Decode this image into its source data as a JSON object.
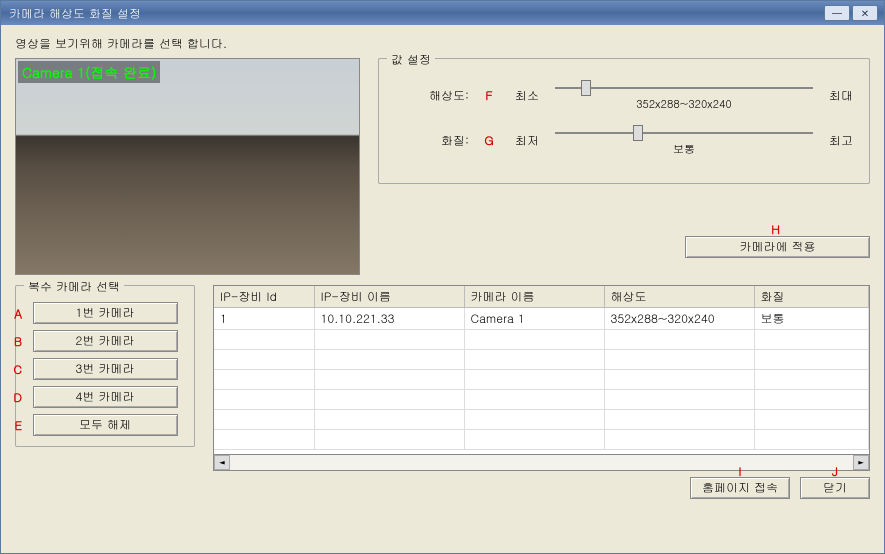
{
  "title": "카메라 해상도 화질 설정",
  "instruction": "영상을 보기위해 카메라를 선택 합니다.",
  "preview": {
    "overlay": "Camera 1(접속 완료)"
  },
  "settings": {
    "legend": "값 설정",
    "resolution": {
      "label": "해상도:",
      "marker": "F",
      "min_label": "최소",
      "max_label": "최대",
      "value_text": "352x288~320x240",
      "pos_pct": 12
    },
    "quality": {
      "label": "화질:",
      "marker": "G",
      "min_label": "최저",
      "max_label": "최고",
      "value_text": "보통",
      "pos_pct": 32
    }
  },
  "apply": {
    "marker": "H",
    "label": "카메라에 적용"
  },
  "multi": {
    "legend": "복수 카메라 선택",
    "rows": [
      {
        "marker": "A",
        "label": "1번 카메라"
      },
      {
        "marker": "B",
        "label": "2번 카메라"
      },
      {
        "marker": "C",
        "label": "3번 카메라"
      },
      {
        "marker": "D",
        "label": "4번 카메라"
      },
      {
        "marker": "E",
        "label": "모두 해제"
      }
    ]
  },
  "table": {
    "headers": {
      "id": "IP-장비 Id",
      "name": "IP-장비 이름",
      "camera": "카메라 이름",
      "resolution": "해상도",
      "quality": "화질"
    },
    "rows": [
      {
        "id": "1",
        "name": "10.10.221.33",
        "camera": "Camera 1",
        "resolution": "352x288~320x240",
        "quality": "보통"
      }
    ]
  },
  "bottom": {
    "marker_i": "I",
    "marker_j": "J",
    "homepage": "홈페이지 접속",
    "close": "닫기"
  }
}
